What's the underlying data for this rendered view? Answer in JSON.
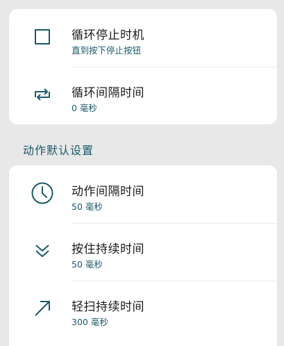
{
  "top_card": {
    "items": [
      {
        "icon": "stop-square-icon",
        "title": "循环停止时机",
        "subtitle": "直到按下停止按钮"
      },
      {
        "icon": "repeat-icon",
        "title": "循环间隔时间",
        "subtitle": "0 毫秒"
      }
    ]
  },
  "section": {
    "header": "动作默认设置"
  },
  "action_card": {
    "items": [
      {
        "icon": "clock-icon",
        "title": "动作间隔时间",
        "subtitle": "50 毫秒"
      },
      {
        "icon": "double-chevron-down-icon",
        "title": "按住持续时间",
        "subtitle": "50 毫秒"
      },
      {
        "icon": "arrow-up-right-icon",
        "title": "轻扫持续时间",
        "subtitle": "300 毫秒"
      }
    ]
  },
  "colors": {
    "accent": "#1a5a6a",
    "background": "#e8e8e8",
    "card": "#ffffff"
  }
}
